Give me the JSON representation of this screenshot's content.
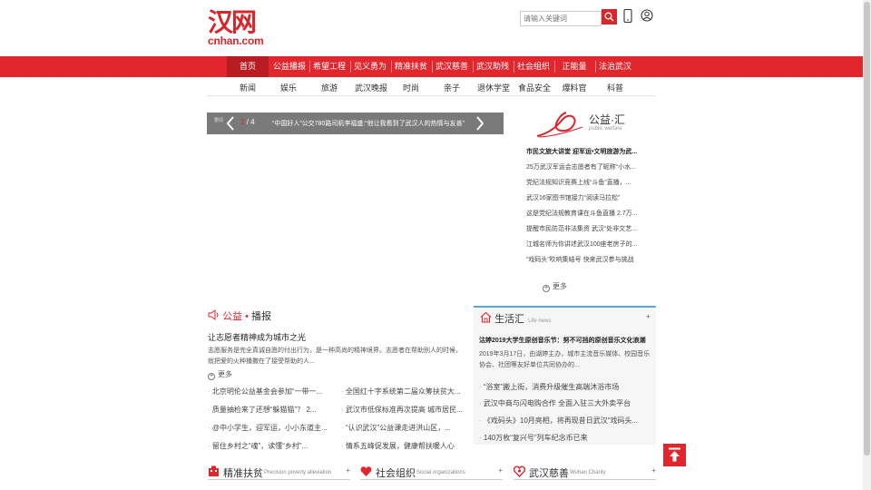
{
  "header": {
    "logo_cn": "汉网",
    "logo_en": "cnhan.com",
    "search_placeholder": "请输入关键词"
  },
  "nav": [
    {
      "label": "首页",
      "active": true
    },
    {
      "label": "公益播报"
    },
    {
      "label": "希望工程"
    },
    {
      "label": "见义勇为"
    },
    {
      "label": "精准扶贫"
    },
    {
      "label": "武汉慈善"
    },
    {
      "label": "武汉助残"
    },
    {
      "label": "社会组织"
    },
    {
      "label": "正能量"
    },
    {
      "label": "法治武汉"
    }
  ],
  "subnav": [
    "新闻",
    "娱乐",
    "旅游",
    "武汉晚报",
    "时尚",
    "亲子",
    "退休学堂",
    "食品安全",
    "爆料官",
    "科普"
  ],
  "slider": {
    "label": "要闻",
    "current": "2",
    "total": "/ 4",
    "caption": "“中国好人”公交780路司机李福盛:“他让我看到了武汉人的热情与友善”"
  },
  "welfare": {
    "title": "公益·汇",
    "subtitle": "public welfare",
    "items": [
      "市民文旅大讲堂 迎军运•文明旅游为武...",
      "25万武汉军运会志愿者有了昵称“小水...",
      "党纪法规知识竞赛上线“斗鱼”直播，...",
      "武汉16家图书馆接力“阅读马拉松”",
      "这是党纪法规教育课在斗鱼直播 2.7万...",
      "提醒市民防范非法集资 武汉“处非文艺...",
      "江城名师为你讲述武汉100座老房子的...",
      "“戏码头”吹响集结号 快来武汉参与挑战"
    ],
    "more": "更多"
  },
  "gongyi": {
    "head_red": "公益",
    "head_dot": "•",
    "head_black": "播报",
    "title": "让志愿者精神成为城市之光",
    "desc": "志愿服务是完全真诚自愿的付出行为，是一种高尚的精神境界。志愿者在帮助别人的时候，就把爱的火种播撒在了接受帮助的人...",
    "more": "更多",
    "items": [
      "北京明伦公益基金会参加“一带一...",
      "全国红十字系统第二届众筹扶贫大...",
      "质量抽检来了还想“躲猫猫”？ 2...",
      "武汉市低保标准再次提高 城市居民...",
      "@中小学生，迎军运，小小东道主...",
      "“认识武汉”公益课走进洪山区，...",
      "留住乡村之“魂”，读懂“乡村”...",
      "情系五峰促发展，健康帮扶暖人心"
    ]
  },
  "life": {
    "title": "生活汇",
    "title_en": "Life news",
    "plus": "+",
    "headline": "沽婷2019大学生原创音乐节：努不可挡的原创音乐文化浪潮",
    "desc": "2019年3月17日，由湖婷主办，城市主流音乐媒体、校园音乐协会、社团等友好单位共同协办的...",
    "items": [
      "“浴室”搬上街，消费升级催生高端沐浴市场",
      "武汉中商与闪电购合作 全面入驻三大外卖平台",
      "《戏码头》10月亮相，将再现昔日武汉“戏码头...",
      "140万枚“复兴号”列车纪念币已来"
    ]
  },
  "bottom_tabs": [
    {
      "name": "精准扶贫",
      "en": "Precision poverty alleviation",
      "plus": "+"
    },
    {
      "name": "社会组织",
      "en": "Social organizations",
      "plus": "+"
    },
    {
      "name": "武汉慈善",
      "en": "Wuhan Charity",
      "plus": "+"
    }
  ],
  "colors": {
    "brand_red": "#e2262e",
    "nav_active": "#b81c22",
    "life_border": "#57a8dc"
  },
  "icons": [
    "search-icon",
    "phone-icon",
    "user-icon",
    "chevron-left-icon",
    "chevron-right-icon",
    "speaker-icon",
    "house-icon",
    "heart-icon",
    "arrow-up-icon"
  ]
}
